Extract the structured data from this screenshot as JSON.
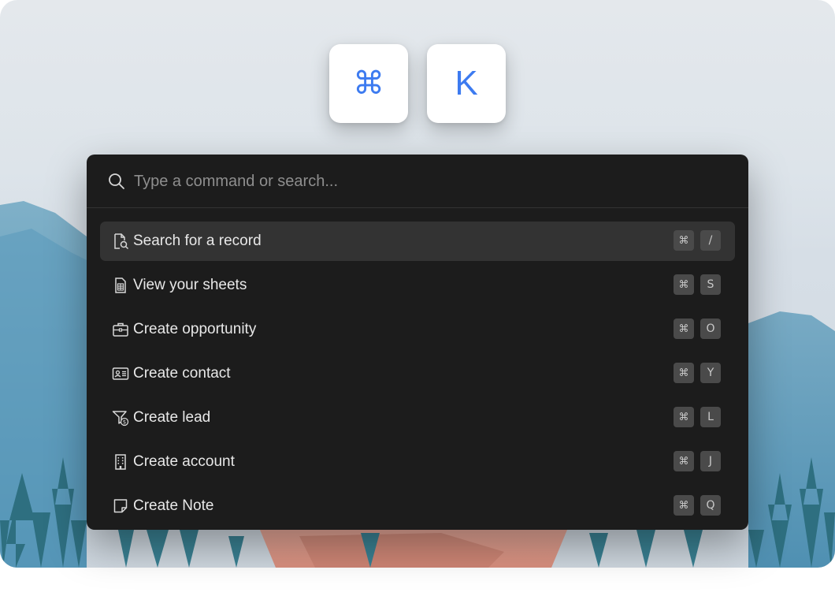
{
  "keys": {
    "cmd": "⌘",
    "letter": "K"
  },
  "search": {
    "placeholder": "Type a command or search..."
  },
  "items": [
    {
      "icon": "search-record-icon",
      "label": "Search for a record",
      "mod": "⌘",
      "key": "/",
      "active": true
    },
    {
      "icon": "sheet-icon",
      "label": "View your sheets",
      "mod": "⌘",
      "key": "S",
      "active": false
    },
    {
      "icon": "briefcase-icon",
      "label": "Create opportunity",
      "mod": "⌘",
      "key": "O",
      "active": false
    },
    {
      "icon": "contact-card-icon",
      "label": "Create contact",
      "mod": "⌘",
      "key": "Y",
      "active": false
    },
    {
      "icon": "funnel-dollar-icon",
      "label": "Create lead",
      "mod": "⌘",
      "key": "L",
      "active": false
    },
    {
      "icon": "building-icon",
      "label": "Create account",
      "mod": "⌘",
      "key": "J",
      "active": false
    },
    {
      "icon": "note-icon",
      "label": "Create Note",
      "mod": "⌘",
      "key": "Q",
      "active": false
    }
  ],
  "colors": {
    "accent": "#3d7bf0",
    "palette_bg": "#1c1c1c",
    "active_row": "#333333",
    "kbd_bg": "#4a4a4a"
  }
}
